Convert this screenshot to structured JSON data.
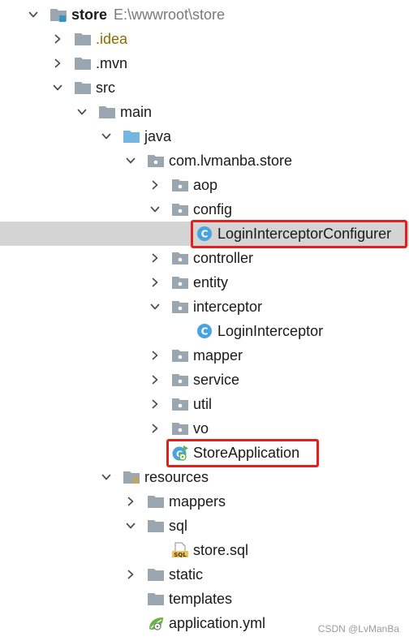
{
  "tree": [
    {
      "id": "store",
      "label": "store",
      "path": "E:\\wwwroot\\store",
      "indent": 0,
      "chevron": "down",
      "icon": "module-folder-icon",
      "bold": true
    },
    {
      "id": "idea",
      "label": ".idea",
      "indent": 1,
      "chevron": "right",
      "icon": "folder-icon",
      "style": "idea"
    },
    {
      "id": "mvn",
      "label": ".mvn",
      "indent": 1,
      "chevron": "right",
      "icon": "folder-icon"
    },
    {
      "id": "src",
      "label": "src",
      "indent": 1,
      "chevron": "down",
      "icon": "folder-icon"
    },
    {
      "id": "main",
      "label": "main",
      "indent": 2,
      "chevron": "down",
      "icon": "folder-icon"
    },
    {
      "id": "java",
      "label": "java",
      "indent": 3,
      "chevron": "down",
      "icon": "source-folder-icon"
    },
    {
      "id": "pkg",
      "label": "com.lvmanba.store",
      "indent": 4,
      "chevron": "down",
      "icon": "package-icon"
    },
    {
      "id": "aop",
      "label": "aop",
      "indent": 5,
      "chevron": "right",
      "icon": "package-icon"
    },
    {
      "id": "config",
      "label": "config",
      "indent": 5,
      "chevron": "down",
      "icon": "package-icon"
    },
    {
      "id": "lic",
      "label": "LoginInterceptorConfigurer",
      "indent": 6,
      "chevron": "none",
      "icon": "class-icon",
      "selected": true
    },
    {
      "id": "controller",
      "label": "controller",
      "indent": 5,
      "chevron": "right",
      "icon": "package-icon"
    },
    {
      "id": "entity",
      "label": "entity",
      "indent": 5,
      "chevron": "right",
      "icon": "package-icon"
    },
    {
      "id": "interceptor",
      "label": "interceptor",
      "indent": 5,
      "chevron": "down",
      "icon": "package-icon"
    },
    {
      "id": "li",
      "label": "LoginInterceptor",
      "indent": 6,
      "chevron": "none",
      "icon": "class-icon"
    },
    {
      "id": "mapper",
      "label": "mapper",
      "indent": 5,
      "chevron": "right",
      "icon": "package-icon"
    },
    {
      "id": "service",
      "label": "service",
      "indent": 5,
      "chevron": "right",
      "icon": "package-icon"
    },
    {
      "id": "util",
      "label": "util",
      "indent": 5,
      "chevron": "right",
      "icon": "package-icon"
    },
    {
      "id": "vo",
      "label": "vo",
      "indent": 5,
      "chevron": "right",
      "icon": "package-icon"
    },
    {
      "id": "app",
      "label": "StoreApplication",
      "indent": 5,
      "chevron": "none",
      "icon": "spring-boot-class-icon"
    },
    {
      "id": "resources",
      "label": "resources",
      "indent": 3,
      "chevron": "down",
      "icon": "resources-folder-icon"
    },
    {
      "id": "mappers",
      "label": "mappers",
      "indent": 4,
      "chevron": "right",
      "icon": "folder-icon"
    },
    {
      "id": "sql",
      "label": "sql",
      "indent": 4,
      "chevron": "down",
      "icon": "folder-icon"
    },
    {
      "id": "storesql",
      "label": "store.sql",
      "indent": 5,
      "chevron": "none",
      "icon": "sql-file-icon"
    },
    {
      "id": "static",
      "label": "static",
      "indent": 4,
      "chevron": "right",
      "icon": "folder-icon"
    },
    {
      "id": "templates",
      "label": "templates",
      "indent": 4,
      "chevron": "none",
      "icon": "folder-icon"
    },
    {
      "id": "appyml",
      "label": "application.yml",
      "indent": 4,
      "chevron": "none",
      "icon": "yaml-leaf-icon"
    }
  ],
  "highlights": [
    "lic",
    "app"
  ],
  "watermark": "CSDN @LvManBa",
  "colors": {
    "highlight_border": "#e3201b",
    "selected_row": "#d4d4d4",
    "folder": "#9aa7b0",
    "source_folder": "#74b6df",
    "class_circle": "#4aa3df",
    "spring_green": "#62b543"
  }
}
